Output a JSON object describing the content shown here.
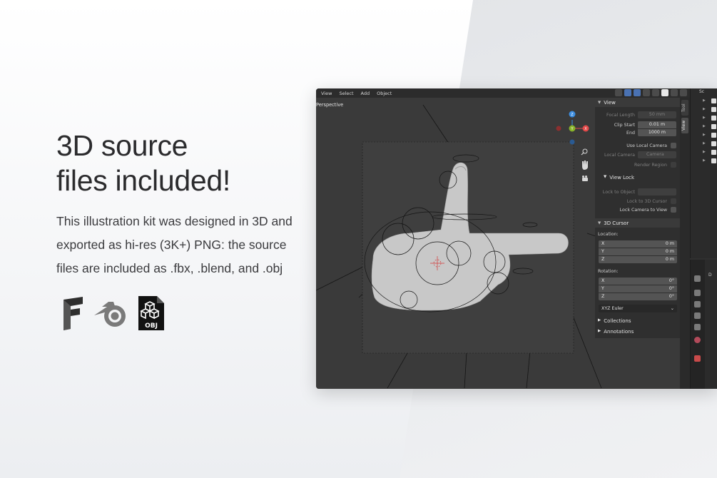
{
  "marketing": {
    "headline_line1": "3D source",
    "headline_line2": "files included!",
    "description_lines": [
      "This illustration kit was designed in 3D and",
      "exported as hi-res (3K+) PNG: the source",
      "files are included as .fbx, .blend, and .obj"
    ],
    "format_icons": [
      "fbx-logo-icon",
      "blender-logo-icon",
      "obj-file-icon"
    ],
    "obj_icon_label": "OBJ"
  },
  "colors": {
    "headline": "#2b2b2d",
    "blender_bg": "#303030",
    "panel_bg": "#2f2f2f",
    "field_bg": "#545454",
    "gizmo_x": "#e24a4a",
    "gizmo_y": "#88b32a",
    "gizmo_z": "#3b8de0"
  },
  "blender": {
    "menu": [
      "View",
      "Select",
      "Add",
      "Object"
    ],
    "viewport_label": "Perspective",
    "gizmo": {
      "z": "Z",
      "y": "Y",
      "x": "X"
    },
    "sidebar_tabs": [
      "Tool",
      "View"
    ],
    "view_panel": {
      "title": "View",
      "focal_length_label": "Focal Length",
      "focal_length_value": "50 mm",
      "clip_start_label": "Clip Start",
      "clip_start_value": "0.01 m",
      "end_label": "End",
      "end_value": "1000 m",
      "use_local_camera": "Use Local Camera",
      "local_camera_label": "Local Camera",
      "local_camera_value": "Camera",
      "render_region": "Render Region"
    },
    "view_lock": {
      "title": "View Lock",
      "lock_to_object": "Lock to Object",
      "lock_to_3d_cursor": "Lock to 3D Cursor",
      "lock_camera_to_view": "Lock Camera to View"
    },
    "cursor_panel": {
      "title": "3D Cursor",
      "location_label": "Location:",
      "location": [
        {
          "axis": "X",
          "value": "0 m"
        },
        {
          "axis": "Y",
          "value": "0 m"
        },
        {
          "axis": "Z",
          "value": "0 m"
        }
      ],
      "rotation_label": "Rotation:",
      "rotation": [
        {
          "axis": "X",
          "value": "0°"
        },
        {
          "axis": "Y",
          "value": "0°"
        },
        {
          "axis": "Z",
          "value": "0°"
        }
      ],
      "rotation_mode": "XYZ Euler"
    },
    "collapsed_panels": [
      "Collections",
      "Annotations"
    ],
    "outliner_header": "Sc",
    "props_header": "D"
  }
}
